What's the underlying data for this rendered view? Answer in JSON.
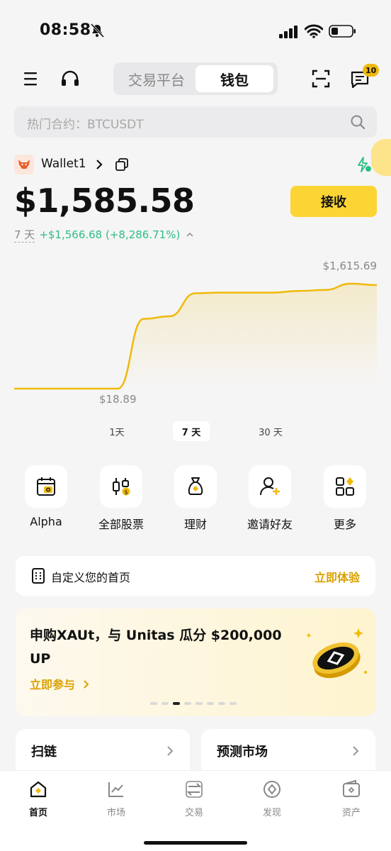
{
  "status_bar": {
    "time": "08:58"
  },
  "header": {
    "tabs": [
      "交易平台",
      "钱包"
    ],
    "active_tab": "钱包",
    "message_badge": "10"
  },
  "search": {
    "placeholder": "热门合约：BTCUSDT"
  },
  "wallet": {
    "name": "Wallet1",
    "balance": "$1,585.58",
    "receive_label": "接收",
    "change_period": "7 天",
    "change_value": "+$1,566.68 (+8,286.71%)"
  },
  "chart_data": {
    "type": "area",
    "x": [
      0,
      0.5,
      1,
      1.5,
      2,
      2.5,
      3,
      3.5,
      4,
      4.5,
      5,
      5.5,
      6,
      6.5,
      7
    ],
    "values": [
      18.89,
      18.89,
      18.89,
      18.89,
      18.89,
      1080,
      1120,
      1470,
      1480,
      1480,
      1480,
      1505,
      1520,
      1615.69,
      1595
    ],
    "max_label": "$1,615.69",
    "min_label": "$18.89",
    "color": "#f0b90b",
    "grid": false
  },
  "ranges": {
    "items": [
      "1天",
      "7 天",
      "30 天"
    ],
    "active": "7 天"
  },
  "shortcuts": [
    {
      "label": "Alpha",
      "icon": "alpha-calendar-icon"
    },
    {
      "label": "全部股票",
      "icon": "stocks-candle-icon"
    },
    {
      "label": "理财",
      "icon": "money-bag-icon"
    },
    {
      "label": "邀请好友",
      "icon": "invite-friend-icon"
    },
    {
      "label": "更多",
      "icon": "more-grid-icon"
    }
  ],
  "custom_home": {
    "text": "自定义您的首页",
    "link": "立即体验"
  },
  "banner": {
    "title": "申购XAUt，与 Unitas 瓜分 $200,000 UP",
    "link": "立即参与",
    "dot_count": 8,
    "active_dot": 2
  },
  "mini_cards": [
    "扫链",
    "预测市场"
  ],
  "tabbar": [
    {
      "label": "首页",
      "icon": "home-icon",
      "active": true
    },
    {
      "label": "市场",
      "icon": "market-chart-icon",
      "active": false
    },
    {
      "label": "交易",
      "icon": "trade-swap-icon",
      "active": false
    },
    {
      "label": "发现",
      "icon": "discover-compass-icon",
      "active": false
    },
    {
      "label": "资产",
      "icon": "wallet-assets-icon",
      "active": false
    }
  ],
  "colors": {
    "brand": "#fcd535",
    "accent": "#d9a100",
    "positive": "#2ebd85"
  }
}
